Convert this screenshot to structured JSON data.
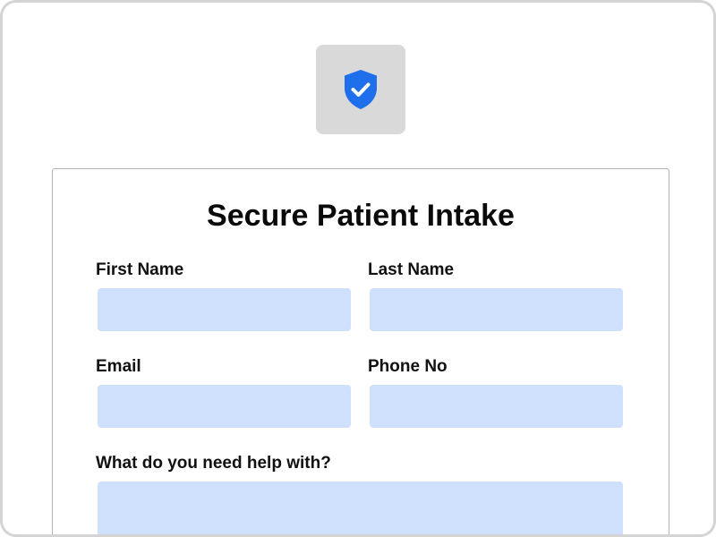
{
  "brand": {
    "logo_icon": "shield-check-icon",
    "tile_color": "#d9d9d9",
    "icon_color": "#1f6fec"
  },
  "form": {
    "title": "Secure Patient Intake",
    "field_color": "#cfe0fc",
    "fields": {
      "first_name": {
        "label": "First Name",
        "value": "",
        "placeholder": ""
      },
      "last_name": {
        "label": "Last Name",
        "value": "",
        "placeholder": ""
      },
      "email": {
        "label": "Email",
        "value": "",
        "placeholder": ""
      },
      "phone": {
        "label": "Phone No",
        "value": "",
        "placeholder": ""
      },
      "help": {
        "label": "What do you need help with?",
        "value": "",
        "placeholder": ""
      }
    }
  }
}
